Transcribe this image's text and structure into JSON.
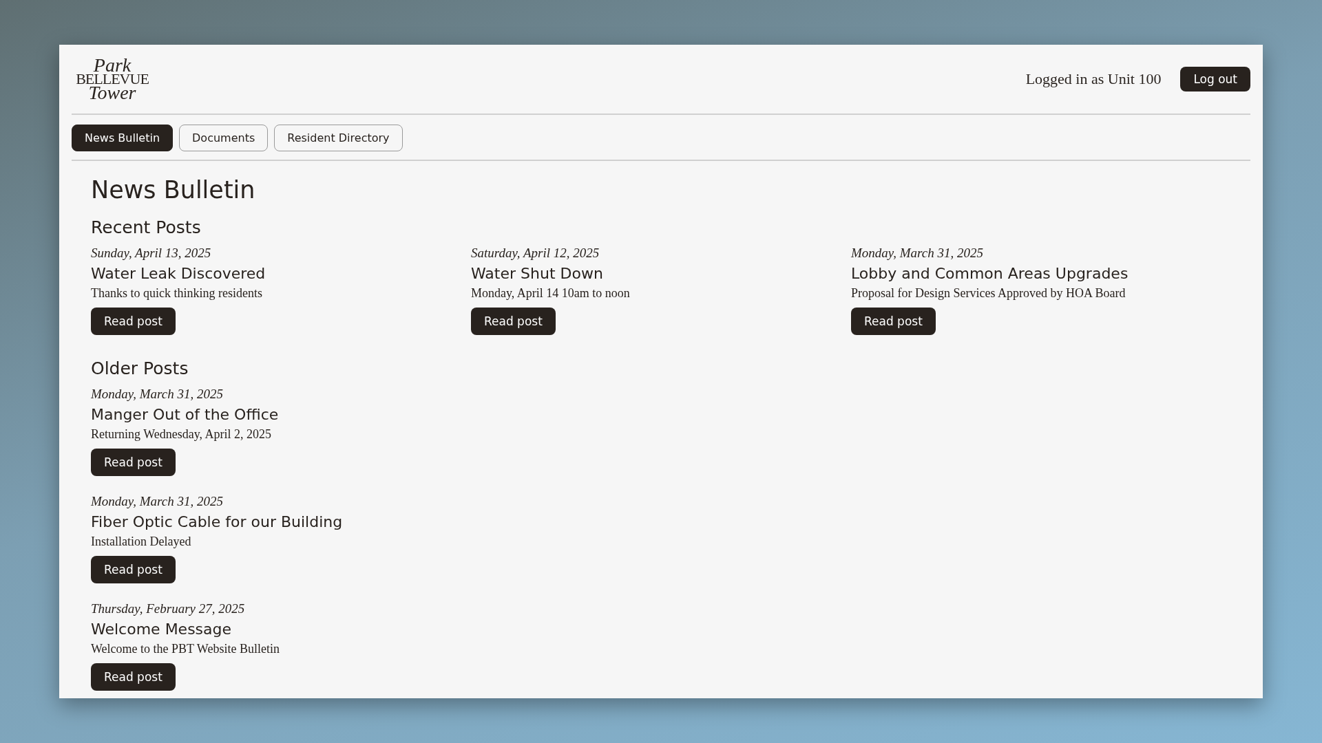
{
  "logo": {
    "lines": [
      "Park",
      "BELLEVUE",
      "Tower"
    ]
  },
  "header": {
    "user_label": "Logged in as Unit 100",
    "logout_button": "Log out"
  },
  "tabs": [
    {
      "label": "News Bulletin",
      "selected": true
    },
    {
      "label": "Documents",
      "selected": false
    },
    {
      "label": "Resident Directory",
      "selected": false
    }
  ],
  "page_title": "News Bulletin",
  "sections": [
    {
      "heading": "Recent Posts",
      "kind": "columns",
      "posts": [
        {
          "date": "Sunday, April 13, 2025",
          "title": "Water Leak Discovered",
          "summary": "Thanks to quick thinking residents",
          "button": "Read post"
        },
        {
          "date": "Saturday, April 12, 2025",
          "title": "Water Shut Down",
          "summary": "Monday, April 14 10am to noon",
          "button": "Read post"
        },
        {
          "date": "Monday, March 31, 2025",
          "title": "Lobby and Common Areas Upgrades",
          "summary": "Proposal for Design Services Approved by HOA Board",
          "button": "Read post"
        }
      ]
    },
    {
      "heading": "Older Posts",
      "kind": "list",
      "posts": [
        {
          "date": "Monday, March 31, 2025",
          "title": "Manger Out of the Office",
          "summary": "Returning Wednesday, April 2, 2025",
          "button": "Read post"
        },
        {
          "date": "Monday, March 31, 2025",
          "title": "Fiber Optic Cable for our Building",
          "summary": "Installation Delayed",
          "button": "Read post"
        },
        {
          "date": "Thursday, February 27, 2025",
          "title": "Welcome Message",
          "summary": "Welcome to the PBT Website Bulletin",
          "button": "Read post"
        }
      ]
    }
  ]
}
